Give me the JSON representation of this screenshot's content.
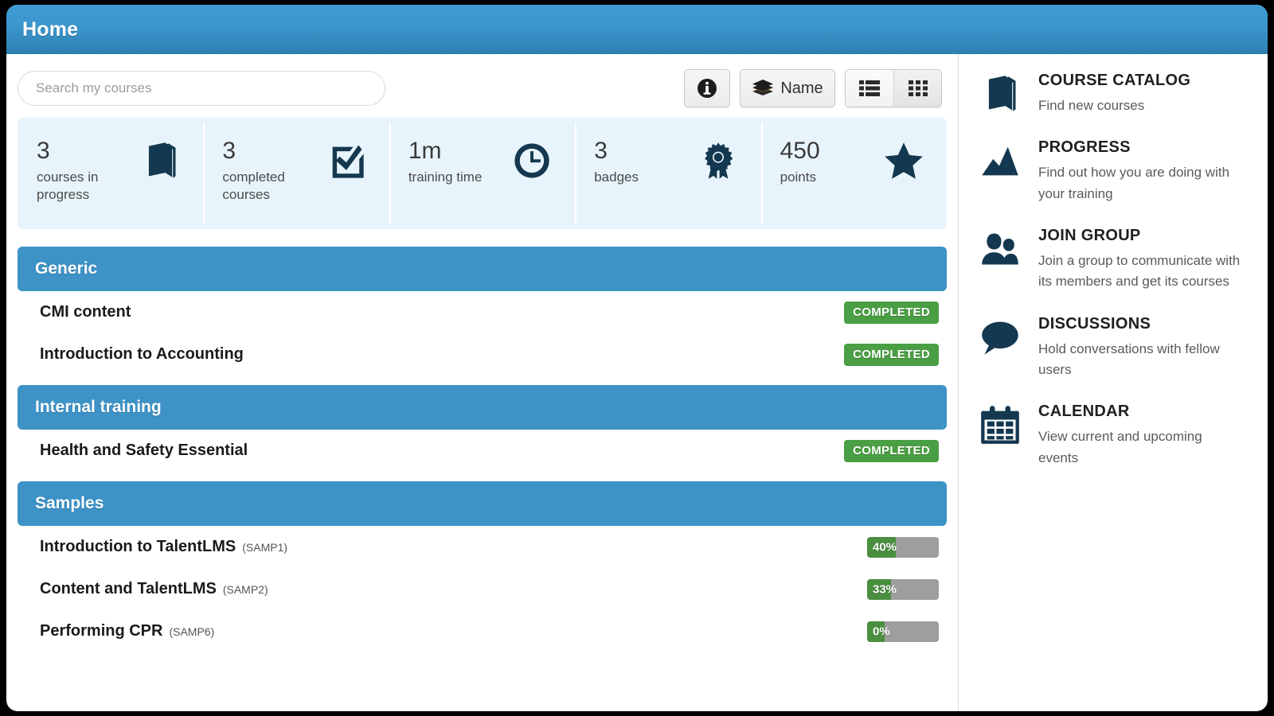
{
  "header": {
    "title": "Home"
  },
  "toolbar": {
    "search_placeholder": "Search my courses",
    "search_value": "",
    "info_label": "Info",
    "sort_label": "Name",
    "list_view_label": "List view",
    "grid_view_label": "Grid view"
  },
  "stats": [
    {
      "value": "3",
      "label": "courses in progress",
      "icon": "book-icon"
    },
    {
      "value": "3",
      "label": "completed courses",
      "icon": "check-square-icon"
    },
    {
      "value": "1m",
      "label": "training time",
      "icon": "clock-icon"
    },
    {
      "value": "3",
      "label": "badges",
      "icon": "ribbon-icon"
    },
    {
      "value": "450",
      "label": "points",
      "icon": "star-icon"
    }
  ],
  "categories": [
    {
      "title": "Generic",
      "courses": [
        {
          "name": "CMI content",
          "code": "",
          "status_type": "completed",
          "status_label": "COMPLETED"
        },
        {
          "name": "Introduction to Accounting",
          "code": "",
          "status_type": "completed",
          "status_label": "COMPLETED"
        }
      ]
    },
    {
      "title": "Internal training",
      "courses": [
        {
          "name": "Health and Safety Essential",
          "code": "",
          "status_type": "completed",
          "status_label": "COMPLETED"
        }
      ]
    },
    {
      "title": "Samples",
      "courses": [
        {
          "name": "Introduction to TalentLMS",
          "code": "(SAMP1)",
          "status_type": "progress",
          "status_label": "40%",
          "progress": 40
        },
        {
          "name": "Content and TalentLMS",
          "code": "(SAMP2)",
          "status_type": "progress",
          "status_label": "33%",
          "progress": 33
        },
        {
          "name": "Performing CPR",
          "code": "(SAMP6)",
          "status_type": "progress",
          "status_label": "0%",
          "progress": 0
        }
      ]
    }
  ],
  "sidebar": [
    {
      "title": "COURSE CATALOG",
      "desc": "Find new courses",
      "icon": "book-icon"
    },
    {
      "title": "PROGRESS",
      "desc": "Find out how you are doing with your training",
      "icon": "chart-icon"
    },
    {
      "title": "JOIN GROUP",
      "desc": "Join a group to communicate with its members and get its courses",
      "icon": "users-icon"
    },
    {
      "title": "DISCUSSIONS",
      "desc": "Hold conversations with fellow users",
      "icon": "speech-bubble-icon"
    },
    {
      "title": "CALENDAR",
      "desc": "View current and upcoming events",
      "icon": "calendar-icon"
    }
  ],
  "colors": {
    "header_blue": "#3b96cd",
    "category_blue": "#3d92c6",
    "stats_bg": "#e8f4fb",
    "icon_navy": "#14384f",
    "badge_green": "#4a9e43",
    "progress_green": "#4a8f3f",
    "progress_track": "#9e9e9e"
  }
}
